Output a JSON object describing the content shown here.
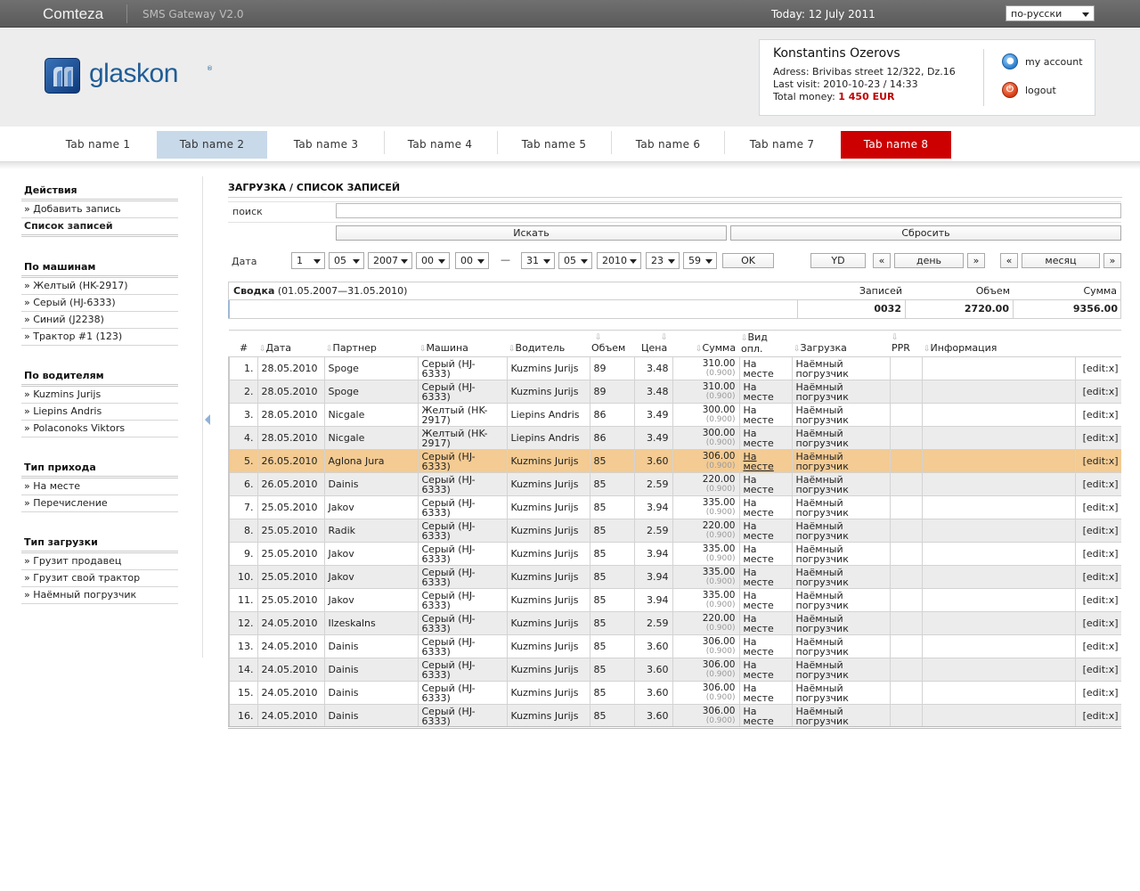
{
  "topbar": {
    "brand": "Comteza",
    "app": "SMS Gateway V2.0",
    "today": "Today: 12 July 2011",
    "language": "по-русски"
  },
  "logo": {
    "text": "glaskon",
    "reg": "®"
  },
  "user": {
    "name": "Konstantins Ozerovs",
    "address": "Adress: Brivibas street 12/322, Dz.16",
    "last_visit": "Last visit: 2010-10-23 / 14:33",
    "money_label": "Total money:",
    "money_value": "1 450 EUR",
    "my_account": "my account",
    "logout": "logout"
  },
  "tabs": [
    "Tab name 1",
    "Tab name 2",
    "Tab name 3",
    "Tab name 4",
    "Tab name 5",
    "Tab name 6",
    "Tab name 7",
    "Tab name 8"
  ],
  "sidebar": {
    "actions": {
      "title": "Действия",
      "items": [
        "» Добавить запись",
        "Список записей"
      ]
    },
    "cars": {
      "title": "По машинам",
      "items": [
        "» Желтый (HK-2917)",
        "» Серый (HJ-6333)",
        "» Синий (J2238)",
        "» Трактор #1 (123)"
      ]
    },
    "drivers": {
      "title": "По водителям",
      "items": [
        "» Kuzmins Jurijs",
        "» Liepins Andris",
        "» Polaconoks Viktors"
      ]
    },
    "income": {
      "title": "Тип прихода",
      "items": [
        "» На месте",
        "» Перечисление"
      ]
    },
    "loading": {
      "title": "Тип загрузки",
      "items": [
        "» Грузит продавец",
        "» Грузит свой трактор",
        "» Наёмный погрузчик"
      ]
    }
  },
  "main": {
    "title": "ЗАГРУЗКА / СПИСОК ЗАПИСЕЙ",
    "search_label": "поиск",
    "search_value": "",
    "search_button": "Искать",
    "reset_button": "Сбросить",
    "date_label": "Дата",
    "from": {
      "day": "1",
      "month": "05",
      "year": "2007",
      "hour": "00",
      "minute": "00"
    },
    "dash": "—",
    "to": {
      "day": "31",
      "month": "05",
      "year": "2010",
      "hour": "23",
      "minute": "59"
    },
    "ok_button": "OK",
    "yd_button": "YD",
    "prev": "«",
    "next": "»",
    "day_label": "день",
    "month_label": "месяц",
    "summary": {
      "label": "Сводка",
      "range": "(01.05.2007—31.05.2010)",
      "records_label": "Записей",
      "volume_label": "Объем",
      "sum_label": "Сумма",
      "records": "0032",
      "volume": "2720.00",
      "sum": "9356.00"
    },
    "columns": [
      "#",
      "Дата",
      "Партнер",
      "Машина",
      "Водитель",
      "Объем",
      "Цена",
      "Сумма",
      "Вид опл.",
      "Загрузка",
      "PPR",
      "Информация"
    ],
    "rows": [
      {
        "n": "1.",
        "date": "28.05.2010",
        "partner": "Spoge",
        "car": "Серый (HJ-6333)",
        "driver": "Kuzmins Jurijs",
        "volume": "89",
        "price": "3.48",
        "sum": "310.00",
        "sum_sub": "(0.900)",
        "pay": "На месте",
        "load": "Наёмный погрузчик",
        "action": "[edit:x]"
      },
      {
        "n": "2.",
        "date": "28.05.2010",
        "partner": "Spoge",
        "car": "Серый (HJ-6333)",
        "driver": "Kuzmins Jurijs",
        "volume": "89",
        "price": "3.48",
        "sum": "310.00",
        "sum_sub": "(0.900)",
        "pay": "На месте",
        "load": "Наёмный погрузчик",
        "action": "[edit:x]"
      },
      {
        "n": "3.",
        "date": "28.05.2010",
        "partner": "Nicgale",
        "car": "Желтый (HK-2917)",
        "driver": "Liepins Andris",
        "volume": "86",
        "price": "3.49",
        "sum": "300.00",
        "sum_sub": "(0.900)",
        "pay": "На месте",
        "load": "Наёмный погрузчик",
        "action": "[edit:x]"
      },
      {
        "n": "4.",
        "date": "28.05.2010",
        "partner": "Nicgale",
        "car": "Желтый (HK-2917)",
        "driver": "Liepins Andris",
        "volume": "86",
        "price": "3.49",
        "sum": "300.00",
        "sum_sub": "(0.900)",
        "pay": "На месте",
        "load": "Наёмный погрузчик",
        "action": "[edit:x]"
      },
      {
        "n": "5.",
        "date": "26.05.2010",
        "partner": "Aglona Jura",
        "car": "Серый (HJ-6333)",
        "driver": "Kuzmins Jurijs",
        "volume": "85",
        "price": "3.60",
        "sum": "306.00",
        "sum_sub": "(0.900)",
        "pay": "На месте",
        "load": "Наёмный погрузчик",
        "action": "[edit:x]"
      },
      {
        "n": "6.",
        "date": "26.05.2010",
        "partner": "Dainis",
        "car": "Серый (HJ-6333)",
        "driver": "Kuzmins Jurijs",
        "volume": "85",
        "price": "2.59",
        "sum": "220.00",
        "sum_sub": "(0.900)",
        "pay": "На месте",
        "load": "Наёмный погрузчик",
        "action": "[edit:x]"
      },
      {
        "n": "7.",
        "date": "25.05.2010",
        "partner": "Jakov",
        "car": "Серый (HJ-6333)",
        "driver": "Kuzmins Jurijs",
        "volume": "85",
        "price": "3.94",
        "sum": "335.00",
        "sum_sub": "(0.900)",
        "pay": "На месте",
        "load": "Наёмный погрузчик",
        "action": "[edit:x]"
      },
      {
        "n": "8.",
        "date": "25.05.2010",
        "partner": "Radik",
        "car": "Серый (HJ-6333)",
        "driver": "Kuzmins Jurijs",
        "volume": "85",
        "price": "2.59",
        "sum": "220.00",
        "sum_sub": "(0.900)",
        "pay": "На месте",
        "load": "Наёмный погрузчик",
        "action": "[edit:x]"
      },
      {
        "n": "9.",
        "date": "25.05.2010",
        "partner": "Jakov",
        "car": "Серый (HJ-6333)",
        "driver": "Kuzmins Jurijs",
        "volume": "85",
        "price": "3.94",
        "sum": "335.00",
        "sum_sub": "(0.900)",
        "pay": "На месте",
        "load": "Наёмный погрузчик",
        "action": "[edit:x]"
      },
      {
        "n": "10.",
        "date": "25.05.2010",
        "partner": "Jakov",
        "car": "Серый (HJ-6333)",
        "driver": "Kuzmins Jurijs",
        "volume": "85",
        "price": "3.94",
        "sum": "335.00",
        "sum_sub": "(0.900)",
        "pay": "На месте",
        "load": "Наёмный погрузчик",
        "action": "[edit:x]"
      },
      {
        "n": "11.",
        "date": "25.05.2010",
        "partner": "Jakov",
        "car": "Серый (HJ-6333)",
        "driver": "Kuzmins Jurijs",
        "volume": "85",
        "price": "3.94",
        "sum": "335.00",
        "sum_sub": "(0.900)",
        "pay": "На месте",
        "load": "Наёмный погрузчик",
        "action": "[edit:x]"
      },
      {
        "n": "12.",
        "date": "24.05.2010",
        "partner": "Ilzeskalns",
        "car": "Серый (HJ-6333)",
        "driver": "Kuzmins Jurijs",
        "volume": "85",
        "price": "2.59",
        "sum": "220.00",
        "sum_sub": "(0.900)",
        "pay": "На месте",
        "load": "Наёмный погрузчик",
        "action": "[edit:x]"
      },
      {
        "n": "13.",
        "date": "24.05.2010",
        "partner": "Dainis",
        "car": "Серый (HJ-6333)",
        "driver": "Kuzmins Jurijs",
        "volume": "85",
        "price": "3.60",
        "sum": "306.00",
        "sum_sub": "(0.900)",
        "pay": "На месте",
        "load": "Наёмный погрузчик",
        "action": "[edit:x]"
      },
      {
        "n": "14.",
        "date": "24.05.2010",
        "partner": "Dainis",
        "car": "Серый (HJ-6333)",
        "driver": "Kuzmins Jurijs",
        "volume": "85",
        "price": "3.60",
        "sum": "306.00",
        "sum_sub": "(0.900)",
        "pay": "На месте",
        "load": "Наёмный погрузчик",
        "action": "[edit:x]"
      },
      {
        "n": "15.",
        "date": "24.05.2010",
        "partner": "Dainis",
        "car": "Серый (HJ-6333)",
        "driver": "Kuzmins Jurijs",
        "volume": "85",
        "price": "3.60",
        "sum": "306.00",
        "sum_sub": "(0.900)",
        "pay": "На месте",
        "load": "Наёмный погрузчик",
        "action": "[edit:x]"
      },
      {
        "n": "16.",
        "date": "24.05.2010",
        "partner": "Dainis",
        "car": "Серый (HJ-6333)",
        "driver": "Kuzmins Jurijs",
        "volume": "85",
        "price": "3.60",
        "sum": "306.00",
        "sum_sub": "(0.900)",
        "pay": "На месте",
        "load": "Наёмный погрузчик",
        "action": "[edit:x]"
      }
    ],
    "highlighted_row": 5
  },
  "colors": {
    "active_tab": "#c8d9e9",
    "alert_tab": "#cc0000",
    "highlight_row": "#f3cb93",
    "money": "#c00000"
  }
}
